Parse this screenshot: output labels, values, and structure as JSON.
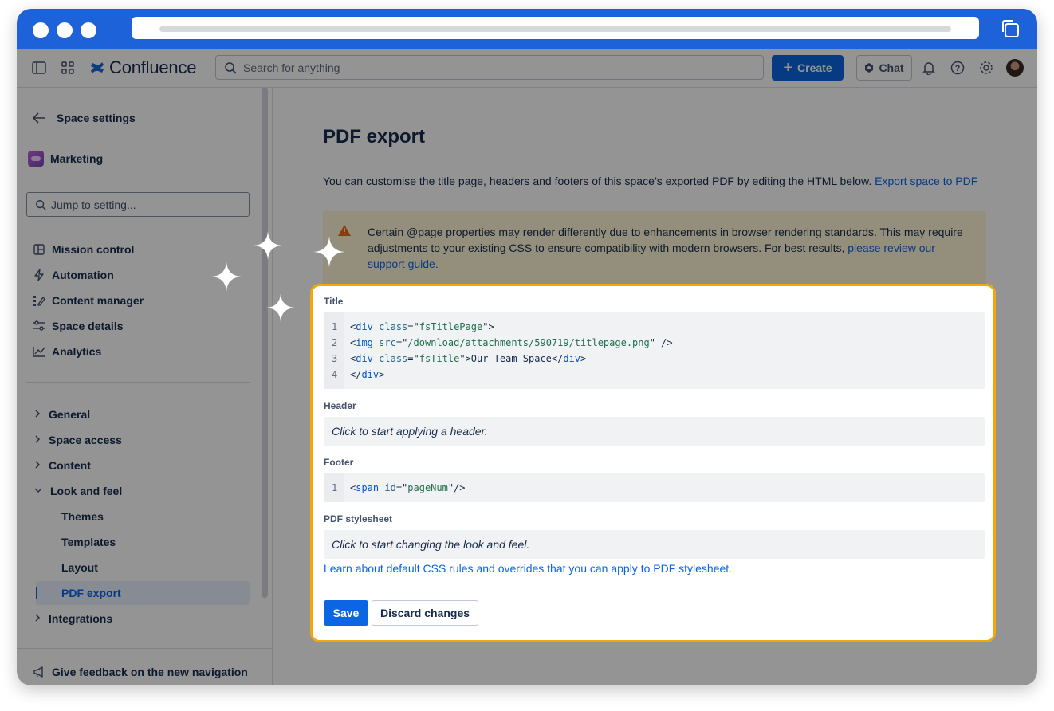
{
  "app": {
    "name": "Confluence"
  },
  "topbar": {
    "search_placeholder": "Search for anything",
    "create_label": "Create",
    "chat_label": "Chat"
  },
  "sidebar": {
    "header": "Space settings",
    "space_name": "Marketing",
    "jump_placeholder": "Jump to setting...",
    "main_items": [
      {
        "label": "Mission control",
        "icon": "layout-icon"
      },
      {
        "label": "Automation",
        "icon": "lightning-icon"
      },
      {
        "label": "Content manager",
        "icon": "list-edit-icon"
      },
      {
        "label": "Space details",
        "icon": "sliders-icon"
      },
      {
        "label": "Analytics",
        "icon": "chart-line-icon"
      }
    ],
    "tree": {
      "general": "General",
      "space_access": "Space access",
      "content": "Content",
      "look_and_feel": "Look and feel",
      "themes": "Themes",
      "templates": "Templates",
      "layout": "Layout",
      "pdf_export": "PDF export",
      "integrations": "Integrations"
    },
    "feedback": "Give feedback on the new navigation"
  },
  "main": {
    "title": "PDF export",
    "intro_text": "You can customise the title page, headers and footers of this space’s exported PDF by editing the HTML below.",
    "intro_link": "Export space to PDF",
    "warning_text": "Certain @page properties may render differently due to enhancements in browser rendering standards. This may require adjustments to your existing CSS to ensure compatibility with modern browsers. For best results,",
    "warning_link": "please review our support guide."
  },
  "form": {
    "title_label": "Title",
    "title_lines": [
      "1",
      "2",
      "3",
      "4"
    ],
    "header_label": "Header",
    "header_placeholder": "Click to start applying a header.",
    "footer_label": "Footer",
    "footer_line_number": "1",
    "stylesheet_label": "PDF stylesheet",
    "stylesheet_placeholder": "Click to start changing the look and feel.",
    "learn_link": "Learn about default CSS rules and overrides that you can apply to PDF stylesheet.",
    "save_label": "Save",
    "discard_label": "Discard changes"
  },
  "colors": {
    "chrome": "#1d62d9",
    "primary": "#0c66e4",
    "highlight_border": "#f5a70a",
    "warning_bg": "#fff7d6"
  }
}
